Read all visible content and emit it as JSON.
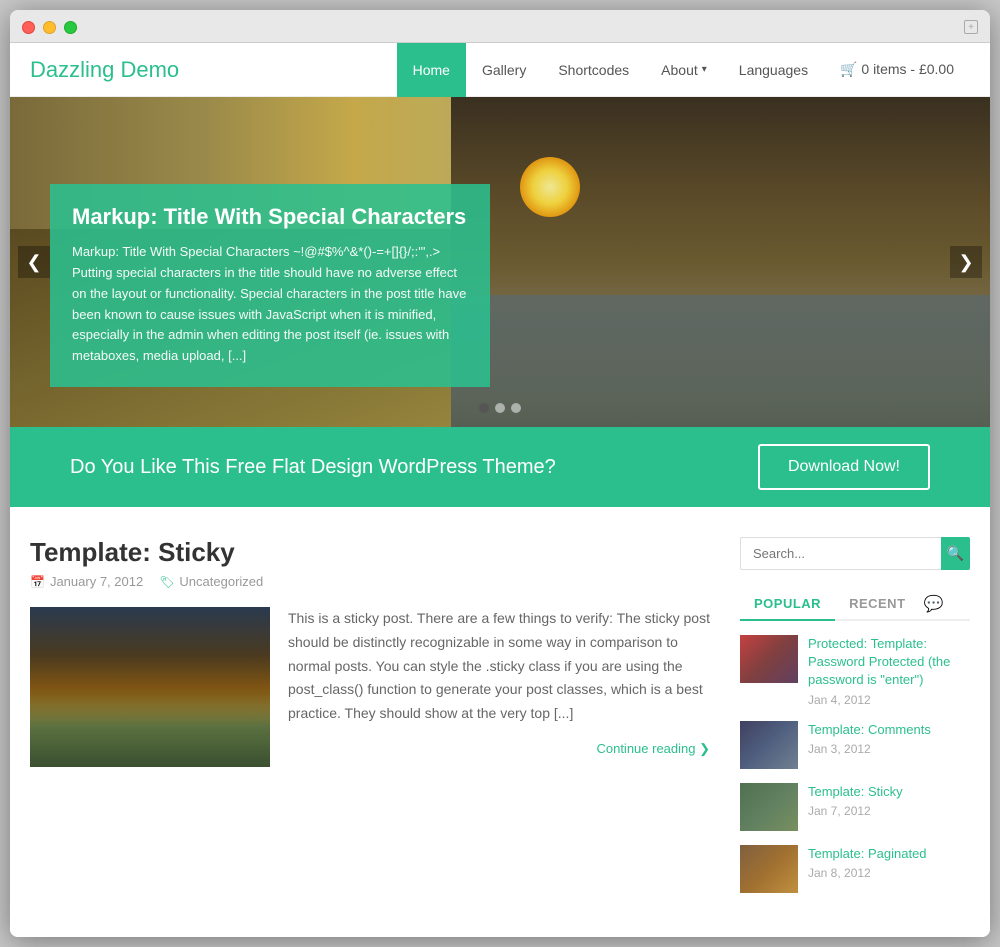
{
  "browser": {
    "expand_label": "+"
  },
  "header": {
    "logo": "Dazzling Demo",
    "nav_items": [
      {
        "label": "Home",
        "active": true
      },
      {
        "label": "Gallery",
        "active": false
      },
      {
        "label": "Shortcodes",
        "active": false
      },
      {
        "label": "About",
        "active": false,
        "has_dropdown": true
      },
      {
        "label": "Languages",
        "active": false
      },
      {
        "label": "🛒 0 items - £0.00",
        "active": false
      }
    ]
  },
  "hero": {
    "slide_title": "Markup: Title With Special Characters",
    "slide_text": "Markup: Title With Special Characters ~!@#$%^&*()-=+[]{}/;:'\",.> Putting special characters in the title should have no adverse effect on the layout or functionality. Special characters in the post title have been known to cause issues with JavaScript when it is minified, especially in the admin when editing the post itself (ie. issues with metaboxes, media upload, [...]",
    "prev_arrow": "❮",
    "next_arrow": "❯",
    "dots": [
      1,
      2,
      3
    ]
  },
  "cta": {
    "text": "Do You Like This Free Flat Design WordPress Theme?",
    "button_label": "Download Now!"
  },
  "post": {
    "title": "Template: Sticky",
    "date": "January 7, 2012",
    "category": "Uncategorized",
    "body": "This is a sticky post. There are a few things to verify: The sticky post should be distinctly recognizable in some way in comparison to normal posts. You can style the .sticky class if you are using the post_class() function to generate your post classes, which is a best practice. They should show at the very top [...]",
    "continue_reading": "Continue reading ❯"
  },
  "sidebar": {
    "search_placeholder": "Search...",
    "tabs": [
      {
        "label": "POPULAR",
        "active": true
      },
      {
        "label": "RECENT",
        "active": false
      }
    ],
    "posts": [
      {
        "title": "Protected: Template: Password Protected (the password is \"enter\")",
        "date": "Jan 4, 2012",
        "thumb_class": "thumb-1"
      },
      {
        "title": "Template: Comments",
        "date": "Jan 3, 2012",
        "thumb_class": "thumb-2"
      },
      {
        "title": "Template: Sticky",
        "date": "Jan 7, 2012",
        "thumb_class": "thumb-3"
      },
      {
        "title": "Template: Paginated",
        "date": "Jan 8, 2012",
        "thumb_class": "thumb-4"
      }
    ]
  },
  "colors": {
    "accent": "#2bbf8e",
    "text_dark": "#333",
    "text_medium": "#666",
    "text_light": "#999"
  }
}
